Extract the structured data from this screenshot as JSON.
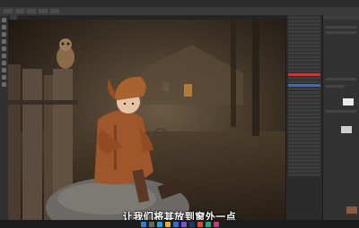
{
  "app": {
    "menu": [
      "",
      "",
      "",
      "",
      "",
      "",
      "",
      "",
      ""
    ],
    "document_tab": ""
  },
  "subtitle": "让我们将其放到窗外一点",
  "colors": {
    "accent_selected_layer": "#c23a3a",
    "panel_bg": "#2b2b2b",
    "workspace_bg": "#111111"
  },
  "taskbar": {
    "icons": [
      "start-icon",
      "search-icon",
      "browser-icon",
      "folder-icon",
      "mail-icon",
      "store-icon",
      "photoshop-icon",
      "chrome-icon",
      "edge-icon",
      "media-icon"
    ]
  }
}
